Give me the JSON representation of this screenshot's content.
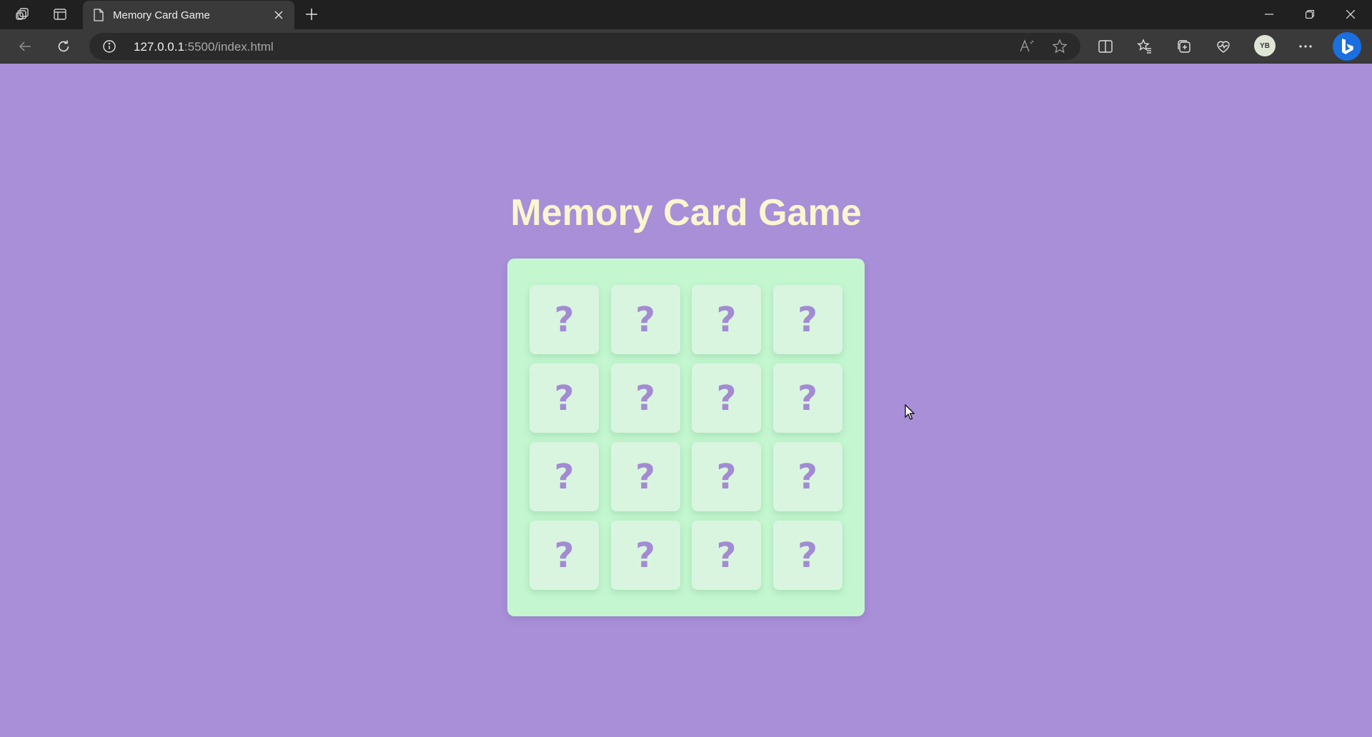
{
  "browser": {
    "tab_title": "Memory Card Game",
    "url_host": "127.0.0.1",
    "url_rest": ":5500/index.html",
    "profile_initials": "YB"
  },
  "icons": {
    "workspaces": "workspaces-icon",
    "tab_actions": "tab-actions-icon",
    "page": "page-icon",
    "close": "close-icon",
    "new_tab": "plus-icon",
    "back": "back-arrow-icon",
    "refresh": "refresh-icon",
    "info": "info-icon",
    "read_aloud": "read-aloud-icon",
    "favorite": "star-icon",
    "split_screen": "split-screen-icon",
    "favorites": "favorites-icon",
    "collections": "collections-icon",
    "performance": "performance-icon",
    "more": "more-icon",
    "copilot": "bing-icon"
  },
  "page": {
    "title": "Memory Card Game",
    "cards": [
      "?",
      "?",
      "?",
      "?",
      "?",
      "?",
      "?",
      "?",
      "?",
      "?",
      "?",
      "?",
      "?",
      "?",
      "?",
      "?"
    ]
  },
  "colors": {
    "background": "#a88fd8",
    "title": "#fbf6cf",
    "board": "#c4f7d0",
    "card": "#d9f5df",
    "question_mark": "#a38bd3"
  }
}
